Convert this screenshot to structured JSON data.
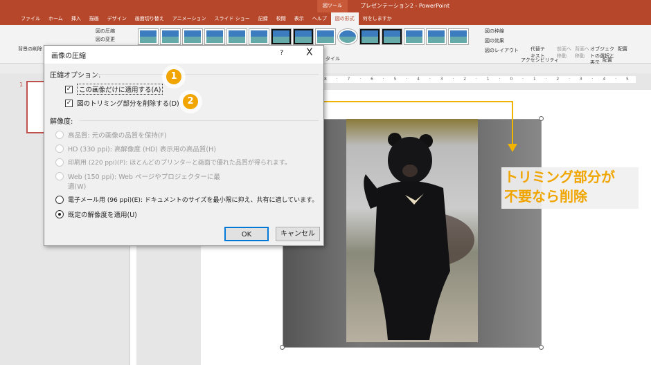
{
  "window": {
    "context_tab": "図ツール",
    "title": "プレゼンテーション2 - PowerPoint"
  },
  "tabs": [
    "ファイル",
    "ホーム",
    "挿入",
    "描画",
    "デザイン",
    "画面切り替え",
    "アニメーション",
    "スライド ショー",
    "記録",
    "校閲",
    "表示",
    "ヘルプ",
    "図の形式",
    "何をしますか"
  ],
  "active_tab": "図の形式",
  "ribbon": {
    "remove_bg": "背景の削除",
    "compress": "図の圧縮",
    "change": "図の変更",
    "border": "図の枠線",
    "effects": "図の効果",
    "layout": "図のレイアウト",
    "styles_group": "タイル",
    "alt_text": "代替テキスト",
    "accessibility": "アクセシビリティ",
    "forward": "前面へ移動",
    "backward": "背面へ移動",
    "selection": "オブジェクトの選択と表示",
    "align": "配置",
    "arrange": "配置"
  },
  "ruler": "8 · 7 · 6 · 5 · 4 · 3 · 2 · 1 · 0 · 1 · 2 · 3 · 4 · 5 · 6 · 7 · 8 · 9 · 10 · 11 · 12",
  "slide_number": "1",
  "dialog": {
    "title": "画像の圧縮",
    "help": "?",
    "close": "X",
    "compress_section": "圧縮オプション:",
    "options": [
      {
        "label": "この画像だけに適用する(A)",
        "checked": true
      },
      {
        "label": "図のトリミング部分を削除する(D)",
        "checked": true
      }
    ],
    "resolution_section": "解像度:",
    "resolutions": [
      {
        "label": "高品質: 元の画像の品質を保持(F)",
        "enabled": false,
        "selected": false
      },
      {
        "label": "HD (330 ppi): 高解像度 (HD) 表示用の高品質(H)",
        "enabled": false,
        "selected": false
      },
      {
        "label": "印刷用 (220 ppi)(P): ほとんどのプリンターと画面で優れた品質が得られます。",
        "enabled": false,
        "selected": false
      },
      {
        "label": "Web (150 ppi): Web ページやプロジェクターに最",
        "label2": "適(W)",
        "enabled": false,
        "selected": false
      },
      {
        "label": "電子メール用 (96 ppi)(E): ドキュメントのサイズを最小限に抑え、共有に適しています。",
        "enabled": true,
        "selected": false
      },
      {
        "label": "既定の解像度を適用(U)",
        "enabled": true,
        "selected": true
      }
    ],
    "ok": "OK",
    "cancel": "キャンセル"
  },
  "annotations": {
    "badge1": "1",
    "badge2": "2",
    "callout_line1": "トリミング部分が",
    "callout_line2": "不要なら削除",
    "accent": "#f0a500"
  }
}
